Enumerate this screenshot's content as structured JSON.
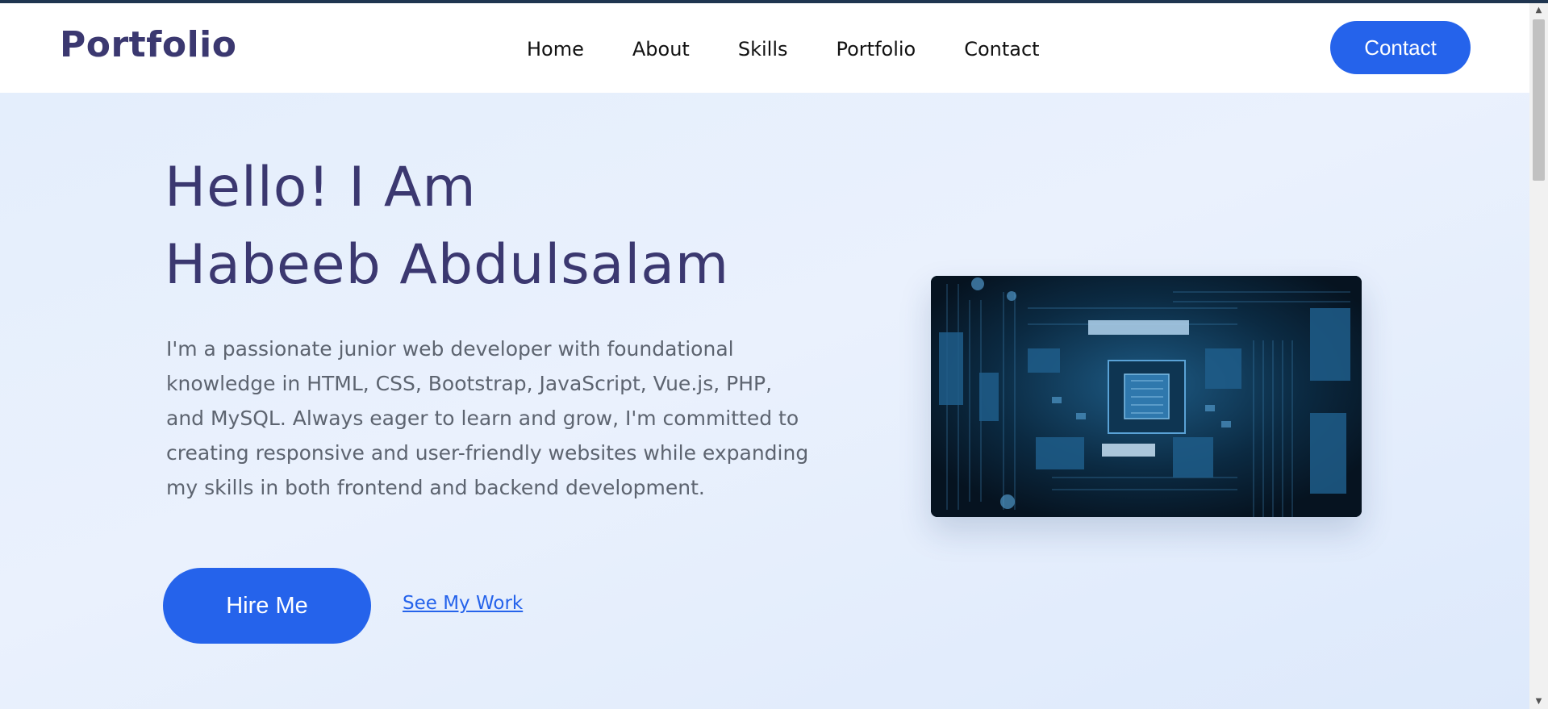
{
  "header": {
    "logo": "Portfolio",
    "nav": [
      "Home",
      "About",
      "Skills",
      "Portfolio",
      "Contact"
    ],
    "contact_button": "Contact"
  },
  "hero": {
    "title_line1": "Hello! I Am",
    "title_line2": "Habeeb Abdulsalam",
    "description": "I'm a passionate junior web developer with foundational knowledge in HTML, CSS, Bootstrap, JavaScript, Vue.js, PHP, and MySQL. Always eager to learn and grow, I'm committed to creating responsive and user-friendly websites while expanding my skills in both frontend and backend development.",
    "hire_button": "Hire Me",
    "see_work_link": "See My Work",
    "image_name": "circuit-board-image"
  },
  "colors": {
    "brand": "#3b3870",
    "accent": "#2563eb"
  }
}
